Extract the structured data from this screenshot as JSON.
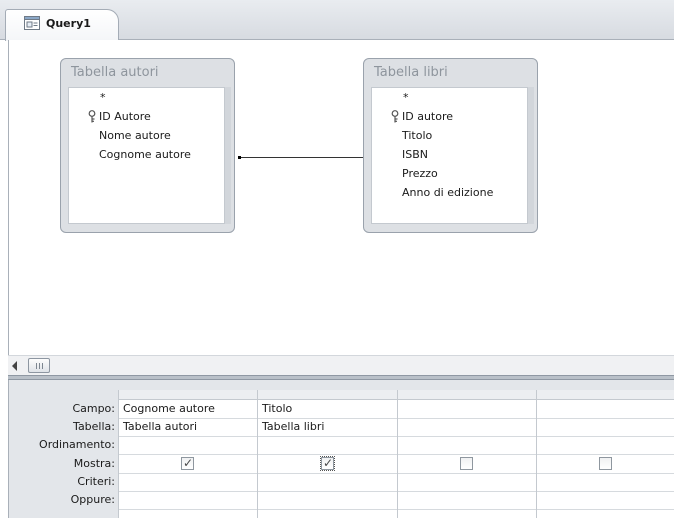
{
  "document_tab": {
    "title": "Query1",
    "icon": "query-icon"
  },
  "tables": [
    {
      "title": "Tabella autori",
      "fields": [
        {
          "name": "*",
          "primary_key": false
        },
        {
          "name": "ID Autore",
          "primary_key": true
        },
        {
          "name": "Nome autore",
          "primary_key": false
        },
        {
          "name": "Cognome autore",
          "primary_key": false
        }
      ]
    },
    {
      "title": "Tabella libri",
      "fields": [
        {
          "name": "*",
          "primary_key": false
        },
        {
          "name": "ID autore",
          "primary_key": true
        },
        {
          "name": "Titolo",
          "primary_key": false
        },
        {
          "name": "ISBN",
          "primary_key": false
        },
        {
          "name": "Prezzo",
          "primary_key": false
        },
        {
          "name": "Anno di edizione",
          "primary_key": false
        }
      ]
    }
  ],
  "relationship": {
    "from": "ID Autore",
    "to": "ID autore"
  },
  "scrollbar": {
    "left_arrow_icon": "arrow-left-icon"
  },
  "grid": {
    "row_labels": {
      "campo": "Campo:",
      "tabella": "Tabella:",
      "ordinamento": "Ordinamento:",
      "mostra": "Mostra:",
      "criteri": "Criteri:",
      "oppure": "Oppure:"
    },
    "columns": [
      {
        "campo": "Cognome autore",
        "tabella": "Tabella autori",
        "ordinamento": "",
        "mostra": true,
        "criteri": "",
        "oppure": ""
      },
      {
        "campo": "Titolo",
        "tabella": "Tabella libri",
        "ordinamento": "",
        "mostra": true,
        "criteri": "",
        "oppure": ""
      },
      {
        "campo": "",
        "tabella": "",
        "ordinamento": "",
        "mostra": false,
        "criteri": "",
        "oppure": ""
      },
      {
        "campo": "",
        "tabella": "",
        "ordinamento": "",
        "mostra": false,
        "criteri": "",
        "oppure": ""
      }
    ]
  }
}
